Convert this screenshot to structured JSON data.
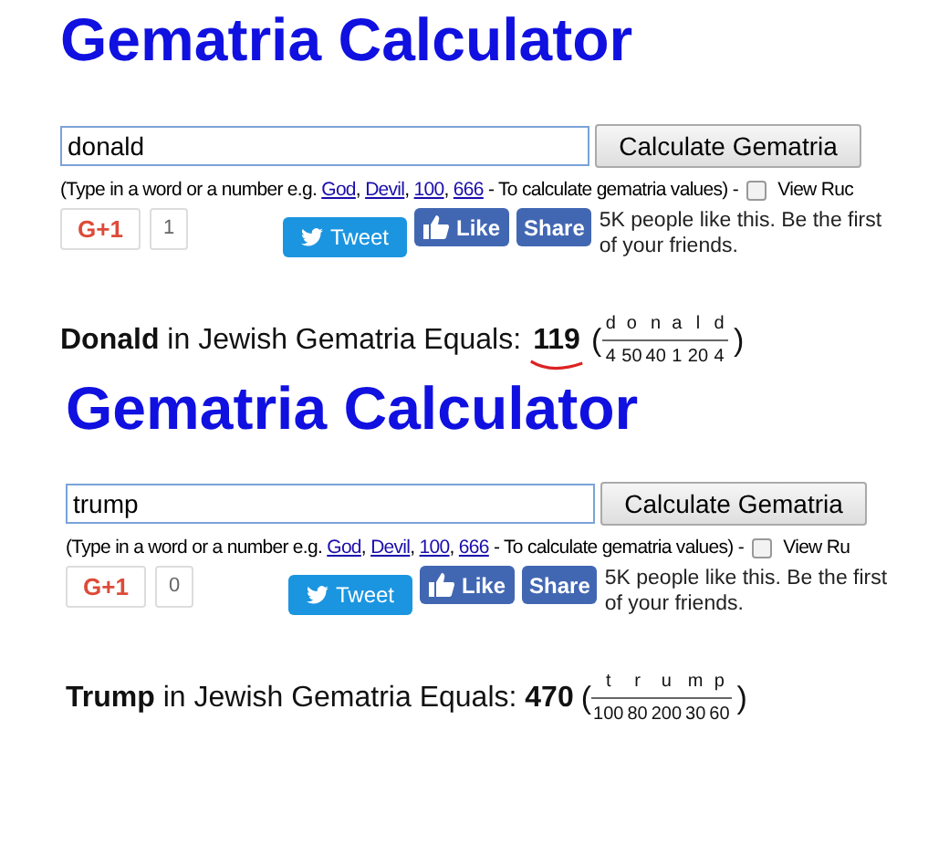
{
  "panels": [
    {
      "title": "Gematria Calculator",
      "input": {
        "value": "donald"
      },
      "button": "Calculate Gematria",
      "hint": {
        "prefix": "(Type in a word or a number e.g. ",
        "links": [
          {
            "text": "God",
            "sep": ", "
          },
          {
            "text": "Devil",
            "sep": ", "
          },
          {
            "text": "100",
            "sep": ", "
          },
          {
            "text": "666"
          }
        ],
        "suffix": " - To calculate gematria values) - "
      },
      "checkbox": {
        "label": "View Ruc",
        "checked": false
      },
      "gplus": {
        "label": "G+1",
        "count": "1"
      },
      "tweet": "Tweet",
      "like": "Like",
      "share": "Share",
      "social_text": "5K people like this. Be the first of your friends.",
      "result": {
        "word": "Donald",
        "text": " in Jewish Gematria Equals: ",
        "total": "119",
        "annotated": true,
        "open": "(",
        "close": ")",
        "letters": [
          {
            "letter": "d",
            "value": "4"
          },
          {
            "letter": "o",
            "value": "50"
          },
          {
            "letter": "n",
            "value": "40"
          },
          {
            "letter": "a",
            "value": "1"
          },
          {
            "letter": "l",
            "value": "20"
          },
          {
            "letter": "d",
            "value": "4"
          }
        ]
      }
    },
    {
      "title": "Gematria Calculator",
      "input": {
        "value": "trump"
      },
      "button": "Calculate Gematria",
      "hint": {
        "prefix": "(Type in a word or a number e.g. ",
        "links": [
          {
            "text": "God",
            "sep": ", "
          },
          {
            "text": "Devil",
            "sep": ", "
          },
          {
            "text": "100",
            "sep": ", "
          },
          {
            "text": "666"
          }
        ],
        "suffix": " - To calculate gematria values) - "
      },
      "checkbox": {
        "label": "View Ru",
        "checked": false
      },
      "gplus": {
        "label": "G+1",
        "count": "0"
      },
      "tweet": "Tweet",
      "like": "Like",
      "share": "Share",
      "social_text": "5K people like this. Be the first of your friends.",
      "result": {
        "word": "Trump",
        "text": " in Jewish Gematria Equals: ",
        "total": "470",
        "annotated": false,
        "open": "(",
        "close": ")",
        "letters": [
          {
            "letter": "t",
            "value": "100"
          },
          {
            "letter": "r",
            "value": "80"
          },
          {
            "letter": "u",
            "value": "200"
          },
          {
            "letter": "m",
            "value": "30"
          },
          {
            "letter": "p",
            "value": "60"
          }
        ]
      }
    }
  ]
}
